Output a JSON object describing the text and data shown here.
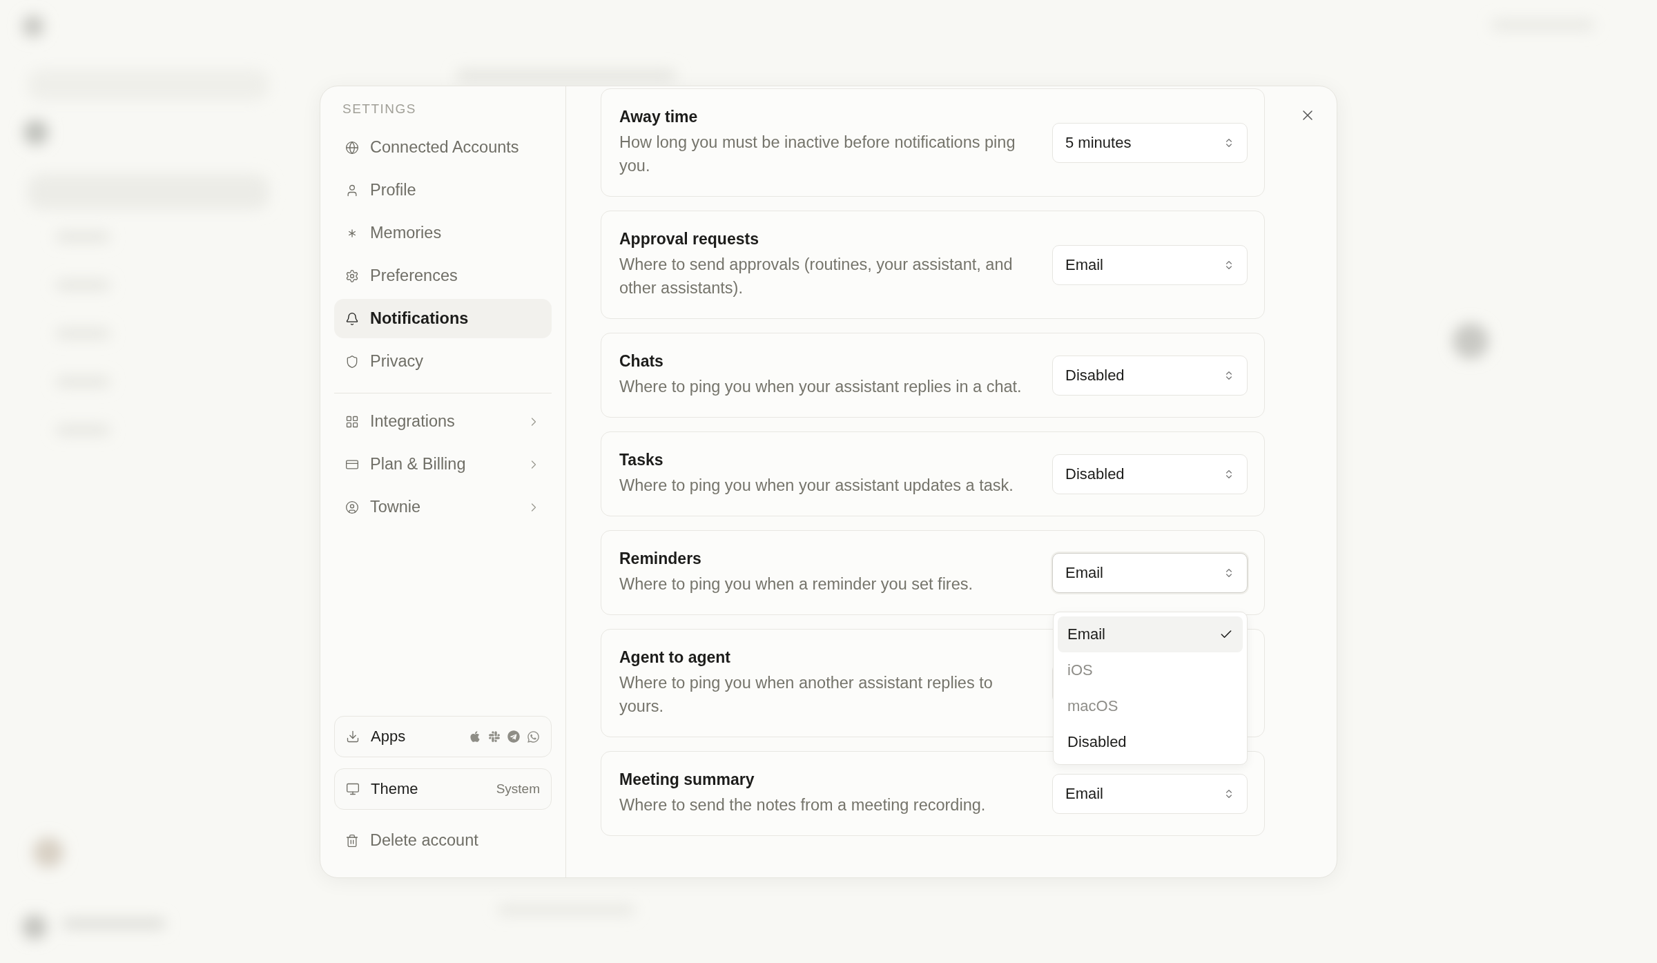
{
  "sidebar": {
    "heading": "SETTINGS",
    "items": [
      {
        "label": "Connected Accounts",
        "selected": false
      },
      {
        "label": "Profile",
        "selected": false
      },
      {
        "label": "Memories",
        "selected": false
      },
      {
        "label": "Preferences",
        "selected": false
      },
      {
        "label": "Notifications",
        "selected": true
      },
      {
        "label": "Privacy",
        "selected": false
      }
    ],
    "links": [
      {
        "label": "Integrations"
      },
      {
        "label": "Plan & Billing"
      },
      {
        "label": "Townie"
      }
    ],
    "apps": {
      "label": "Apps"
    },
    "theme": {
      "label": "Theme",
      "value": "System"
    },
    "delete": {
      "label": "Delete account"
    }
  },
  "settings": [
    {
      "title": "Away time",
      "description": "How long you must be inactive before notifications ping you.",
      "value": "5 minutes"
    },
    {
      "title": "Approval requests",
      "description": "Where to send approvals (routines, your assistant, and other assistants).",
      "value": "Email"
    },
    {
      "title": "Chats",
      "description": "Where to ping you when your assistant replies in a chat.",
      "value": "Disabled"
    },
    {
      "title": "Tasks",
      "description": "Where to ping you when your assistant updates a task.",
      "value": "Disabled"
    },
    {
      "title": "Reminders",
      "description": "Where to ping you when a reminder you set fires.",
      "value": "Email",
      "expanded": true
    },
    {
      "title": "Agent to agent",
      "description": "Where to ping you when another assistant replies to yours."
    },
    {
      "title": "Meeting summary",
      "description": "Where to send the notes from a meeting recording.",
      "value": "Email"
    }
  ],
  "dropdown": {
    "options": [
      {
        "label": "Email",
        "selected": true,
        "disabled": false
      },
      {
        "label": "iOS",
        "selected": false,
        "disabled": true
      },
      {
        "label": "macOS",
        "selected": false,
        "disabled": true
      },
      {
        "label": "Disabled",
        "selected": false,
        "disabled": false
      }
    ]
  }
}
